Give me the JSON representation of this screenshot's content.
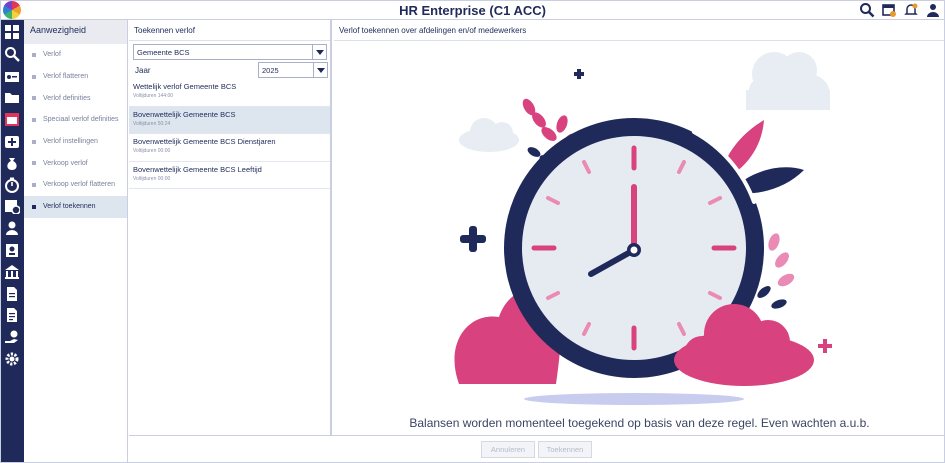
{
  "app": {
    "title": "HR Enterprise (C1 ACC)"
  },
  "top_icons": [
    "search-user-icon",
    "calendar-check-icon",
    "bell-icon",
    "user-icon"
  ],
  "rail_icons": [
    "grid-icon",
    "search-icon",
    "id-card-icon",
    "folder-icon",
    "calendar-icon",
    "medical-icon",
    "money-bag-icon",
    "timer-icon",
    "calendar-clock-icon",
    "person-icon",
    "badge-icon",
    "bank-icon",
    "document-icon",
    "document-list-icon",
    "hand-coin-icon",
    "settings-icon"
  ],
  "sidebar": {
    "title": "Aanwezigheid",
    "items": [
      {
        "label": "Verlof"
      },
      {
        "label": "Verlof flatteren"
      },
      {
        "label": "Verlof definities"
      },
      {
        "label": "Speciaal verlof definities"
      },
      {
        "label": "Verlof instellingen"
      },
      {
        "label": "Verkoop verlof"
      },
      {
        "label": "Verkoop verlof flatteren"
      },
      {
        "label": "Verlof toekennen"
      }
    ]
  },
  "col2": {
    "title": "Toekennen verlof",
    "org_select": "Gemeente BCS",
    "year_label": "Jaar",
    "year_select": "2025",
    "rules": [
      {
        "name": "Wettelijk verlof Gemeente BCS",
        "sub": "Voltijduren 144:00"
      },
      {
        "name": "Bovenwettelijk Gemeente BCS",
        "sub": "Voltijduren 50:24"
      },
      {
        "name": "Bovenwettelijk Gemeente BCS Dienstjaren",
        "sub": "Voltijduren 00:00"
      },
      {
        "name": "Bovenwettelijk Gemeente BCS Leeftijd",
        "sub": "Voltijduren 00:00"
      }
    ]
  },
  "main": {
    "title": "Verlof toekennen over afdelingen en/of medewerkers",
    "message": "Balansen worden momenteel toegekend op basis van deze regel. Even wachten a.u.b."
  },
  "footer": {
    "cancel_label": "Annuleren",
    "grant_label": "Toekennen"
  },
  "colors": {
    "navy": "#1f2a5a",
    "pink": "#d8427f",
    "light_pink": "#e98bb4",
    "cloud": "#e8edf3",
    "selected": "#dde6ef"
  }
}
